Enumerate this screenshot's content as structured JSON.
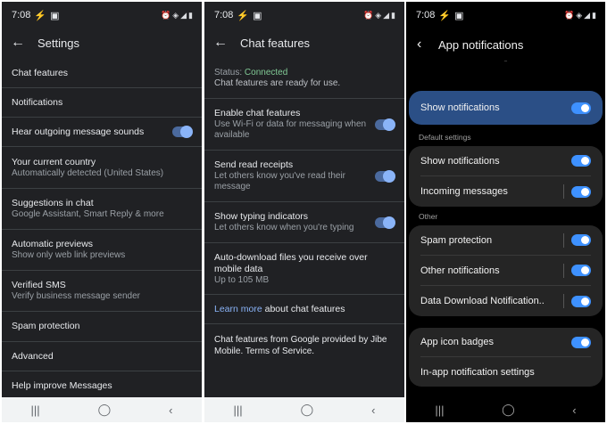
{
  "panel1": {
    "status_time": "7:08",
    "title": "Settings",
    "items": [
      {
        "title": "Chat features"
      },
      {
        "title": "Notifications"
      },
      {
        "title": "Hear outgoing message sounds",
        "toggle": true
      },
      {
        "title": "Your current country",
        "sub": "Automatically detected (United States)"
      },
      {
        "title": "Suggestions in chat",
        "sub": "Google Assistant, Smart Reply & more"
      },
      {
        "title": "Automatic previews",
        "sub": "Show only web link previews"
      },
      {
        "title": "Verified SMS",
        "sub": "Verify business message sender"
      },
      {
        "title": "Spam protection"
      },
      {
        "title": "Advanced"
      },
      {
        "title": "Help improve Messages"
      }
    ]
  },
  "panel2": {
    "status_time": "7:08",
    "title": "Chat features",
    "status_label": "Status: ",
    "status_value": "Connected",
    "status_sub": "Chat features are ready for use.",
    "items": [
      {
        "title": "Enable chat features",
        "sub": "Use Wi-Fi or data for messaging when available",
        "toggle": true
      },
      {
        "title": "Send read receipts",
        "sub": "Let others know you've read their message",
        "toggle": true
      },
      {
        "title": "Show typing indicators",
        "sub": "Let others know when you're typing",
        "toggle": true
      },
      {
        "title": "Auto-download files you receive over mobile data",
        "sub": "Up to 105 MB"
      }
    ],
    "learn_more": "Learn more",
    "learn_more_rest": " about chat features",
    "footer": "Chat features from Google provided by Jibe Mobile. Terms of Service."
  },
  "panel3": {
    "status_time": "7:08",
    "title": "App notifications",
    "main_toggle_label": "Show notifications",
    "section_default": "Default settings",
    "default_items": [
      "Show notifications",
      "Incoming messages"
    ],
    "section_other": "Other",
    "other_items": [
      "Spam protection",
      "Other notifications",
      "Data Download Notification.."
    ],
    "bottom_items": [
      "App icon badges",
      "In-app notification settings"
    ]
  },
  "colors": {
    "accent_link": "#8ab4f8",
    "connected_green": "#81c995",
    "samsung_toggle": "#3e91ff",
    "samsung_highlight": "#2b4f86"
  },
  "icons": [
    "back-arrow-icon",
    "lightning-icon",
    "image-icon",
    "alarm-icon",
    "wifi-icon",
    "signal-icon",
    "battery-icon",
    "recents-icon",
    "home-icon",
    "nav-back-icon"
  ]
}
